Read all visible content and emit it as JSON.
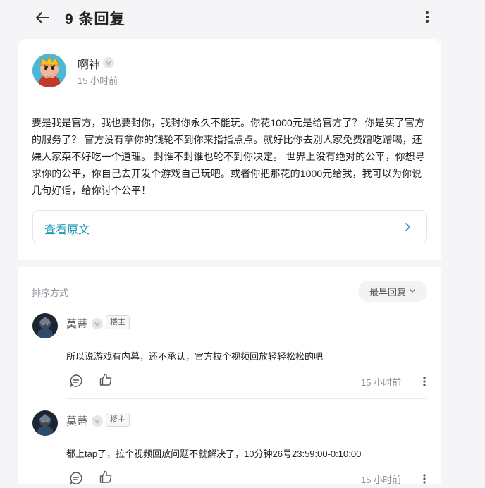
{
  "header": {
    "title": "9 条回复"
  },
  "post": {
    "author": "啊神",
    "time": "15 小时前",
    "body": "要是我是官方，我也要封你，我封你永久不能玩。你花1000元是给官方了？ 你是买了官方的服务了？ 官方没有拿你的钱轮不到你来指指点点。就好比你去别人家免费蹭吃蹭喝，还嫌人家菜不好吃一个道理。 封谁不封谁也轮不到你决定。 世界上没有绝对的公平，你想寻求你的公平，你自己去开发个游戏自己玩吧。或者你把那花的1000元给我，我可以为你说几句好话，给你讨个公平！",
    "view_original": "查看原文"
  },
  "comments_section": {
    "sort_label": "排序方式",
    "sort_value": "最早回复"
  },
  "comments": [
    {
      "author": "莫蒂",
      "tag": "楼主",
      "text": "所以说游戏有内幕，还不承认，官方拉个视频回放轻轻松松的吧",
      "time": "15 小时前"
    },
    {
      "author": "莫蒂",
      "tag": "楼主",
      "text": "都上tap了，拉个视频回放问题不就解决了，10分钟26号23:59:00-0:10:00",
      "time": "15 小时前"
    }
  ],
  "colors": {
    "accent": "#1e9bb7",
    "background": "#f5f5f7",
    "muted_text": "#8a8f99"
  },
  "icons": [
    "back-arrow-icon",
    "more-vertical-icon",
    "verified-badge-icon",
    "chevron-right-icon",
    "chevron-down-icon",
    "comment-icon",
    "thumbs-up-icon"
  ]
}
